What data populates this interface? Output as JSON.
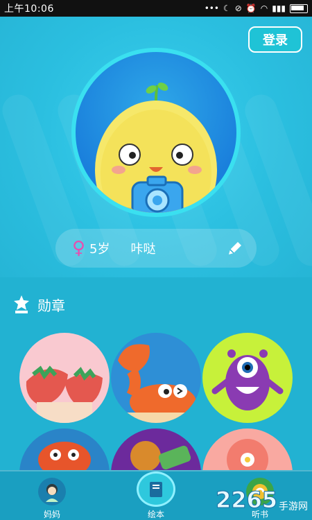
{
  "status_bar": {
    "time": "上午10:06",
    "icons": [
      "ellipsis-icon",
      "moon-icon",
      "alarm-off-icon",
      "alarm-icon",
      "wifi-icon",
      "signal-icon",
      "battery-icon"
    ]
  },
  "header": {
    "login_label": "登录",
    "gender_symbol": "♀",
    "age": "5岁",
    "nickname": "咔哒"
  },
  "badges": {
    "title": "勋章",
    "items": [
      {
        "name": "strawberries-badge"
      },
      {
        "name": "crab-badge"
      },
      {
        "name": "purple-monster-badge"
      },
      {
        "name": "crab-badge-2"
      },
      {
        "name": "food-badge"
      },
      {
        "name": "flower-badge"
      }
    ]
  },
  "nav": {
    "items": [
      {
        "label": "妈妈",
        "icon": "mom-avatar-icon"
      },
      {
        "label": "绘本",
        "icon": "book-icon"
      },
      {
        "label": "听书",
        "icon": "listen-icon"
      }
    ]
  },
  "watermark": {
    "number": "2265",
    "text": "手游网"
  },
  "colors": {
    "primary": "#2bbfe0",
    "accent_pink": "#e84db0",
    "nav": "#1a9fc1"
  }
}
